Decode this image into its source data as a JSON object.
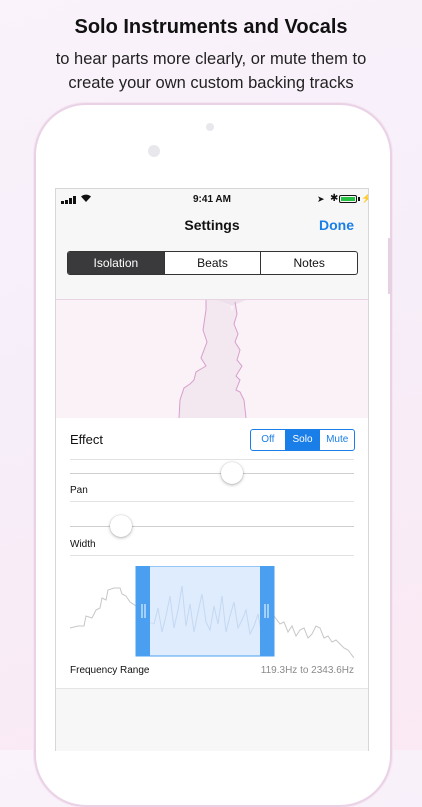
{
  "promo": {
    "title": "Solo Instruments and Vocals",
    "subtitle_line1": "to hear parts more clearly, or mute them to",
    "subtitle_line2": "create your own custom backing tracks"
  },
  "status_bar": {
    "time": "9:41 AM",
    "battery_percent": 100
  },
  "nav": {
    "title": "Settings",
    "done_label": "Done"
  },
  "tabs": [
    {
      "label": "Isolation",
      "active": true
    },
    {
      "label": "Beats",
      "active": false
    },
    {
      "label": "Notes",
      "active": false
    }
  ],
  "effect": {
    "label": "Effect",
    "options": [
      {
        "label": "Off",
        "active": false
      },
      {
        "label": "Solo",
        "active": true
      },
      {
        "label": "Mute",
        "active": false
      }
    ]
  },
  "pan": {
    "label": "Pan",
    "value": 0.57
  },
  "width": {
    "label": "Width",
    "value": 0.18
  },
  "frequency_range": {
    "label": "Frequency Range",
    "value_text": "119.3Hz to 2343.6Hz"
  },
  "colors": {
    "accent": "#1a7ee8",
    "range_fill": "#d3e6fd",
    "range_handle": "#4a9ff0",
    "spectrum_line": "#c7c7c7"
  }
}
